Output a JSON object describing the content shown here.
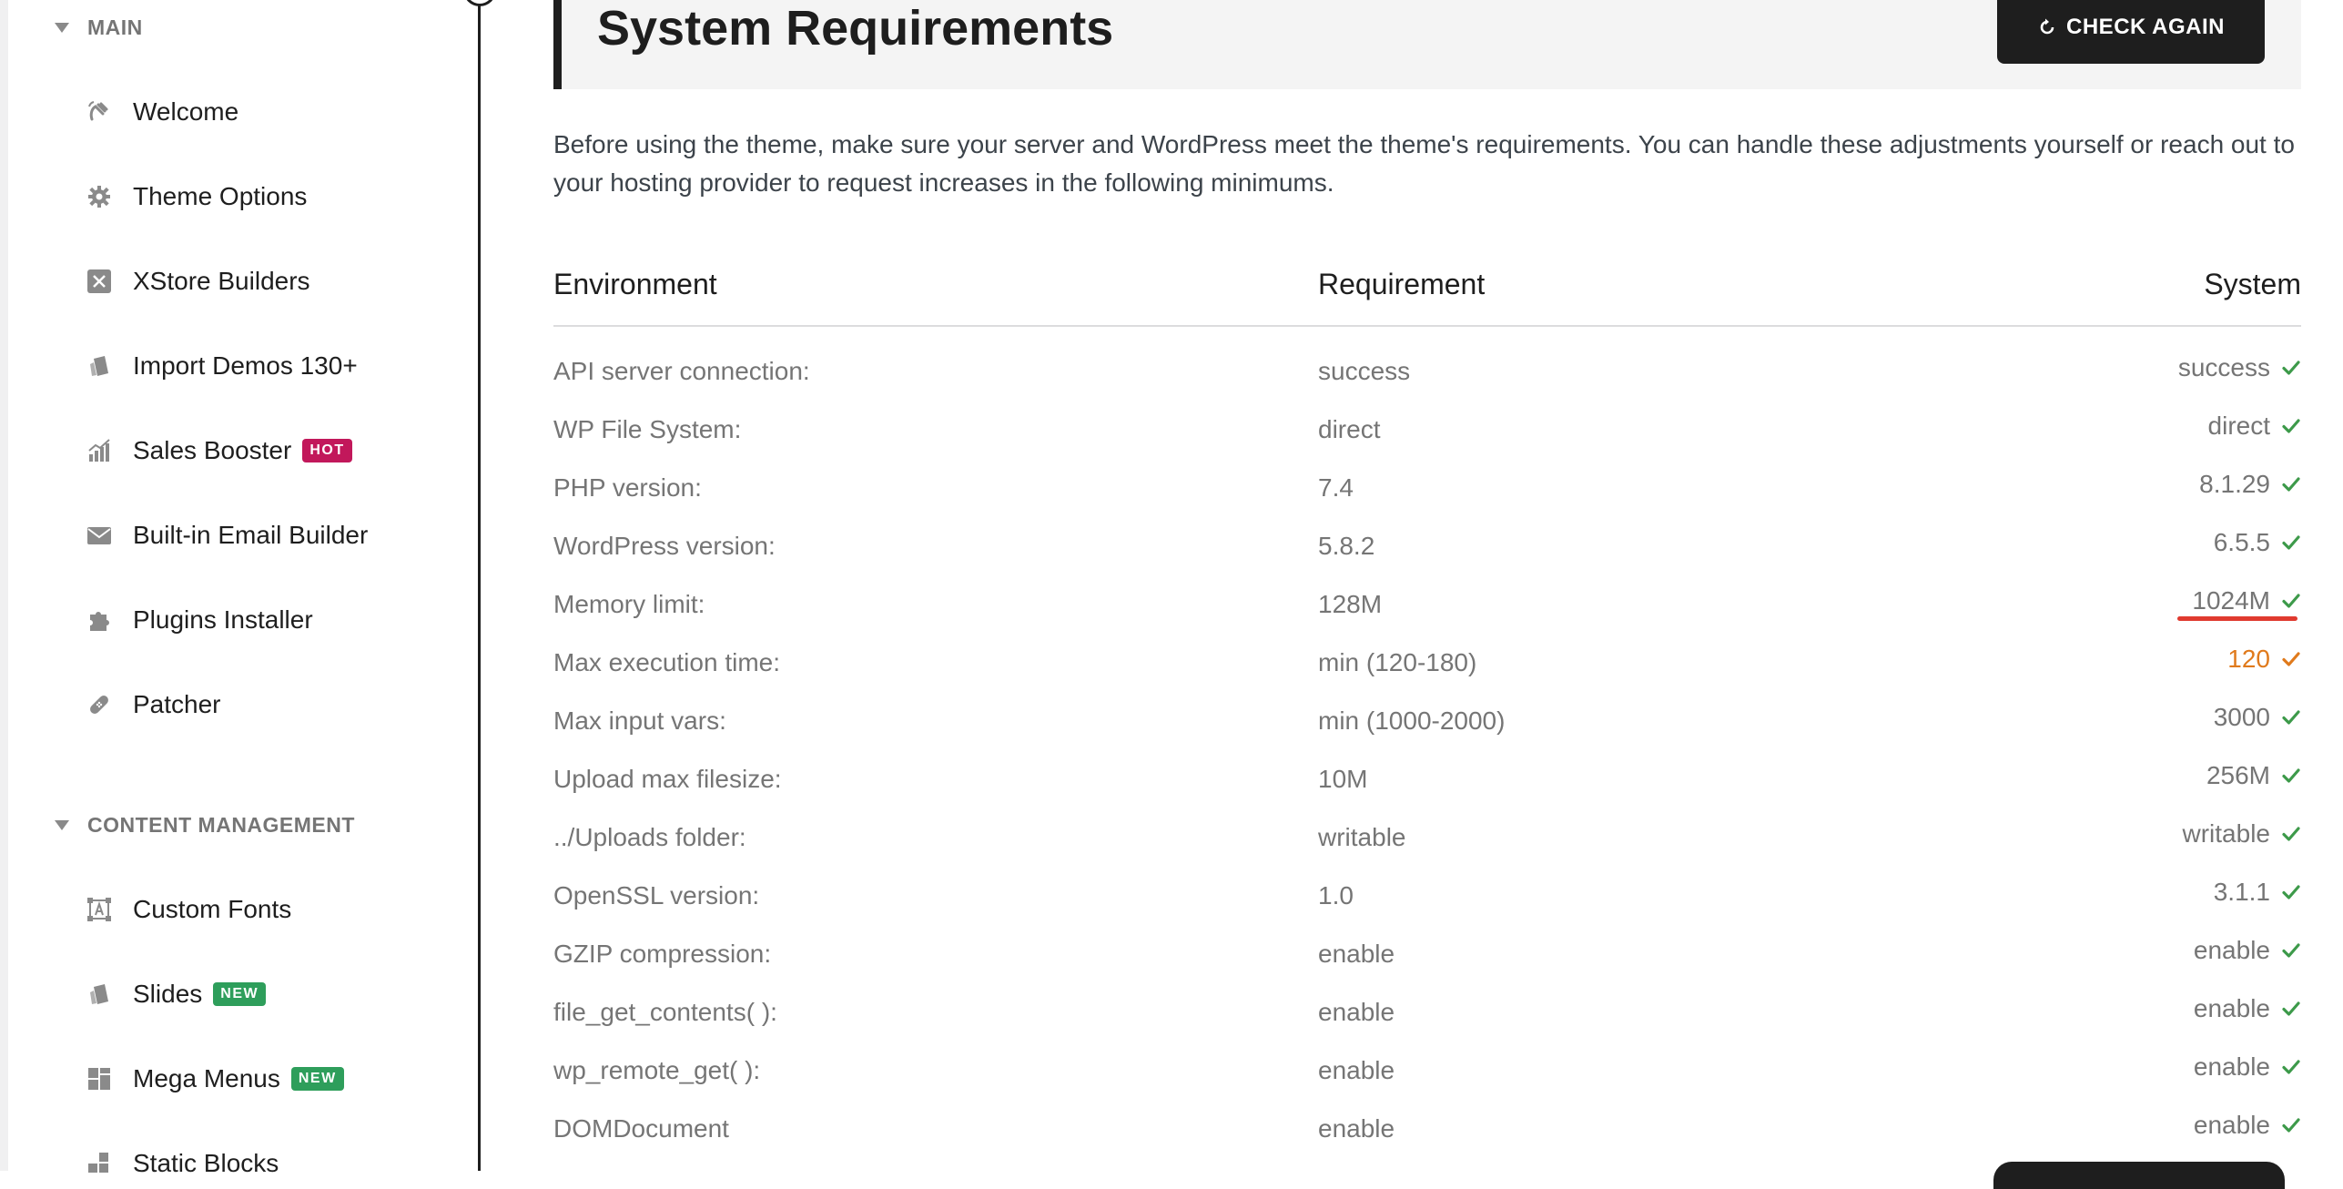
{
  "sidebar": {
    "sections": [
      {
        "title": "MAIN",
        "items": [
          {
            "label": "Welcome",
            "icon": "hand-wave-icon"
          },
          {
            "label": "Theme Options",
            "icon": "gear-icon"
          },
          {
            "label": "XStore Builders",
            "icon": "x-square-icon"
          },
          {
            "label": "Import Demos 130+",
            "icon": "import-icon"
          },
          {
            "label": "Sales Booster",
            "icon": "chart-icon",
            "badge": "HOT"
          },
          {
            "label": "Built-in Email Builder",
            "icon": "envelope-icon"
          },
          {
            "label": "Plugins Installer",
            "icon": "puzzle-icon"
          },
          {
            "label": "Patcher",
            "icon": "bandage-icon"
          }
        ]
      },
      {
        "title": "CONTENT MANAGEMENT",
        "items": [
          {
            "label": "Custom Fonts",
            "icon": "font-frame-icon"
          },
          {
            "label": "Slides",
            "icon": "slides-icon",
            "badge": "NEW"
          },
          {
            "label": "Mega Menus",
            "icon": "grid-icon",
            "badge": "NEW"
          },
          {
            "label": "Static Blocks",
            "icon": "blocks-icon"
          }
        ]
      }
    ]
  },
  "header": {
    "title": "System Requirements",
    "check_again_label": "CHECK AGAIN"
  },
  "intro": "Before using the theme, make sure your server and WordPress meet the theme's requirements. You can handle these adjustments yourself or reach out to your hosting provider to request increases in the following minimums.",
  "table": {
    "headers": {
      "environment": "Environment",
      "requirement": "Requirement",
      "system": "System"
    },
    "rows": [
      {
        "env": "API server connection:",
        "req": "success",
        "sys": "success",
        "status": "ok"
      },
      {
        "env": "WP File System:",
        "req": "direct",
        "sys": "direct",
        "status": "ok"
      },
      {
        "env": "PHP version:",
        "req": "7.4",
        "sys": "8.1.29",
        "status": "ok"
      },
      {
        "env": "WordPress version:",
        "req": "5.8.2",
        "sys": "6.5.5",
        "status": "ok"
      },
      {
        "env": "Memory limit:",
        "req": "128M",
        "sys": "1024M",
        "status": "ok"
      },
      {
        "env": "Max execution time:",
        "req": "min (120-180)",
        "sys": "120",
        "status": "warning"
      },
      {
        "env": "Max input vars:",
        "req": "min (1000-2000)",
        "sys": "3000",
        "status": "ok"
      },
      {
        "env": "Upload max filesize:",
        "req": "10M",
        "sys": "256M",
        "status": "ok"
      },
      {
        "env": "../Uploads folder:",
        "req": "writable",
        "sys": "writable",
        "status": "ok"
      },
      {
        "env": "OpenSSL version:",
        "req": "1.0",
        "sys": "3.1.1",
        "status": "ok"
      },
      {
        "env": "GZIP compression:",
        "req": "enable",
        "sys": "enable",
        "status": "ok"
      },
      {
        "env": "file_get_contents( ):",
        "req": "enable",
        "sys": "enable",
        "status": "ok"
      },
      {
        "env": "wp_remote_get( ):",
        "req": "enable",
        "sys": "enable",
        "status": "ok"
      },
      {
        "env": "DOMDocument",
        "req": "enable",
        "sys": "enable",
        "status": "ok"
      }
    ]
  },
  "colors": {
    "ok": "#3d9a4a",
    "warning": "#e07a1c",
    "hot_badge": "#c2185b",
    "new_badge": "#2e9e5b",
    "annotation": "#e03a2f"
  }
}
